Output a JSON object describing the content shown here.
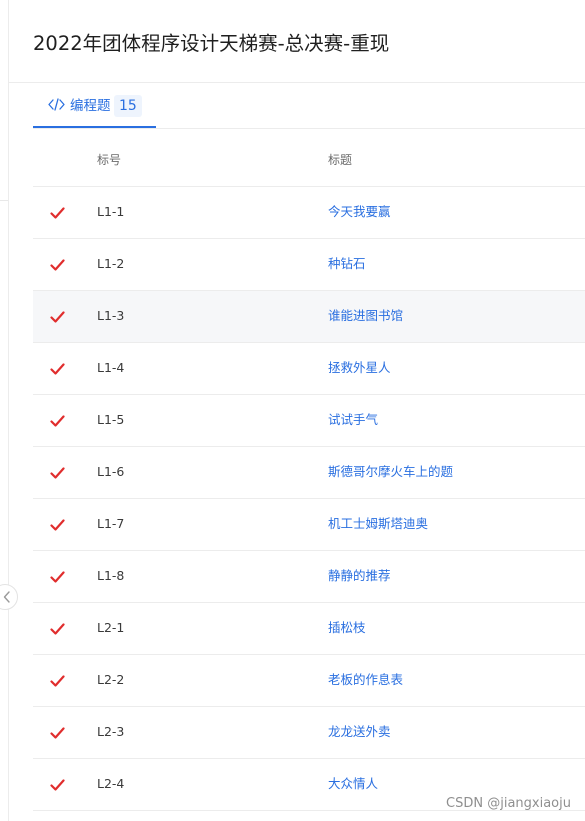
{
  "page": {
    "title": "2022年团体程序设计天梯赛-总决赛-重现"
  },
  "tabs": [
    {
      "label": "编程题",
      "count": "15",
      "icon": "code-icon",
      "active": true
    }
  ],
  "table": {
    "columns": {
      "id": "标号",
      "title": "标题"
    },
    "rows": [
      {
        "status": "check-icon",
        "id": "L1-1",
        "title": "今天我要赢"
      },
      {
        "status": "check-icon",
        "id": "L1-2",
        "title": "种钻石"
      },
      {
        "status": "check-icon",
        "id": "L1-3",
        "title": "谁能进图书馆"
      },
      {
        "status": "check-icon",
        "id": "L1-4",
        "title": "拯救外星人"
      },
      {
        "status": "check-icon",
        "id": "L1-5",
        "title": "试试手气"
      },
      {
        "status": "check-icon",
        "id": "L1-6",
        "title": "斯德哥尔摩火车上的题"
      },
      {
        "status": "check-icon",
        "id": "L1-7",
        "title": "机工士姆斯塔迪奥"
      },
      {
        "status": "check-icon",
        "id": "L1-8",
        "title": "静静的推荐"
      },
      {
        "status": "check-icon",
        "id": "L2-1",
        "title": "插松枝"
      },
      {
        "status": "check-icon",
        "id": "L2-2",
        "title": "老板的作息表"
      },
      {
        "status": "check-icon",
        "id": "L2-3",
        "title": "龙龙送外卖"
      },
      {
        "status": "check-icon",
        "id": "L2-4",
        "title": "大众情人"
      }
    ]
  },
  "watermark": "CSDN @jiangxiaoju",
  "colors": {
    "accent": "#2a6fe0",
    "check": "#e02d2d",
    "border": "#ececec",
    "hover_row": "#f6f7f9"
  }
}
